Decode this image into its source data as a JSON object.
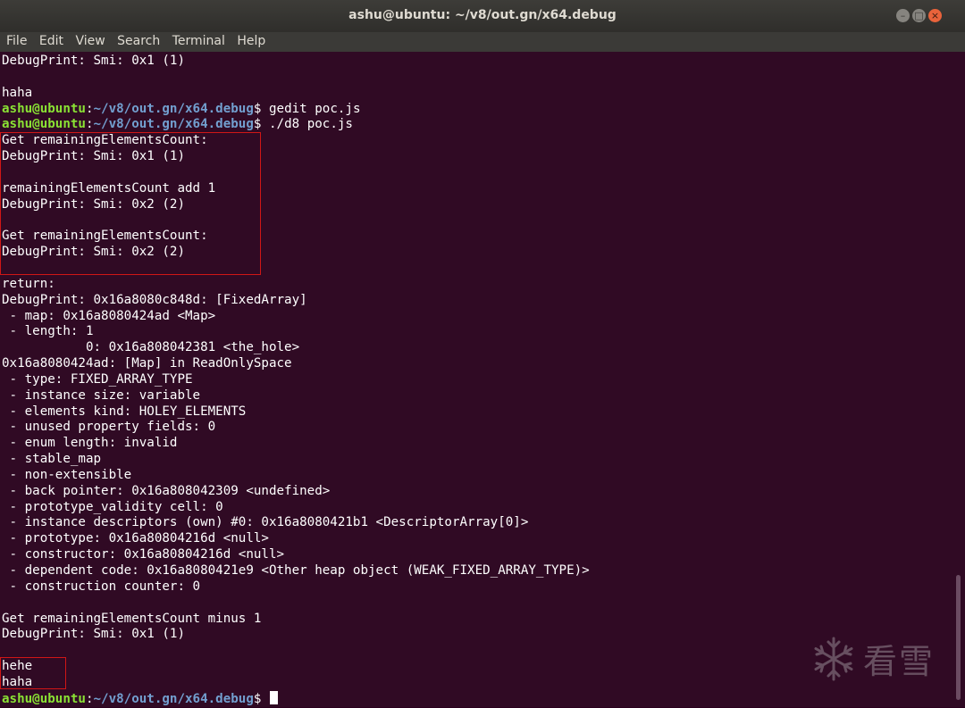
{
  "window": {
    "title": "ashu@ubuntu: ~/v8/out.gn/x64.debug"
  },
  "menu": [
    "File",
    "Edit",
    "View",
    "Search",
    "Terminal",
    "Help"
  ],
  "prompt": {
    "user": "ashu@ubuntu",
    "path": "~/v8/out.gn/x64.debug"
  },
  "lines": [
    {
      "kind": "out",
      "text": "DebugPrint: Smi: 0x1 (1)"
    },
    {
      "kind": "out",
      "text": ""
    },
    {
      "kind": "out",
      "text": "haha"
    },
    {
      "kind": "prompt",
      "text": "gedit poc.js"
    },
    {
      "kind": "prompt",
      "text": "./d8 poc.js"
    },
    {
      "kind": "out",
      "text": "Get remainingElementsCount:"
    },
    {
      "kind": "out",
      "text": "DebugPrint: Smi: 0x1 (1)"
    },
    {
      "kind": "out",
      "text": ""
    },
    {
      "kind": "out",
      "text": "remainingElementsCount add 1"
    },
    {
      "kind": "out",
      "text": "DebugPrint: Smi: 0x2 (2)"
    },
    {
      "kind": "out",
      "text": ""
    },
    {
      "kind": "out",
      "text": "Get remainingElementsCount:"
    },
    {
      "kind": "out",
      "text": "DebugPrint: Smi: 0x2 (2)"
    },
    {
      "kind": "out",
      "text": ""
    },
    {
      "kind": "out",
      "text": "return:"
    },
    {
      "kind": "out",
      "text": "DebugPrint: 0x16a8080c848d: [FixedArray]"
    },
    {
      "kind": "out",
      "text": " - map: 0x16a8080424ad <Map>"
    },
    {
      "kind": "out",
      "text": " - length: 1"
    },
    {
      "kind": "out",
      "text": "           0: 0x16a808042381 <the_hole>"
    },
    {
      "kind": "out",
      "text": "0x16a8080424ad: [Map] in ReadOnlySpace"
    },
    {
      "kind": "out",
      "text": " - type: FIXED_ARRAY_TYPE"
    },
    {
      "kind": "out",
      "text": " - instance size: variable"
    },
    {
      "kind": "out",
      "text": " - elements kind: HOLEY_ELEMENTS"
    },
    {
      "kind": "out",
      "text": " - unused property fields: 0"
    },
    {
      "kind": "out",
      "text": " - enum length: invalid"
    },
    {
      "kind": "out",
      "text": " - stable_map"
    },
    {
      "kind": "out",
      "text": " - non-extensible"
    },
    {
      "kind": "out",
      "text": " - back pointer: 0x16a808042309 <undefined>"
    },
    {
      "kind": "out",
      "text": " - prototype_validity cell: 0"
    },
    {
      "kind": "out",
      "text": " - instance descriptors (own) #0: 0x16a8080421b1 <DescriptorArray[0]>"
    },
    {
      "kind": "out",
      "text": " - prototype: 0x16a80804216d <null>"
    },
    {
      "kind": "out",
      "text": " - constructor: 0x16a80804216d <null>"
    },
    {
      "kind": "out",
      "text": " - dependent code: 0x16a8080421e9 <Other heap object (WEAK_FIXED_ARRAY_TYPE)>"
    },
    {
      "kind": "out",
      "text": " - construction counter: 0"
    },
    {
      "kind": "out",
      "text": ""
    },
    {
      "kind": "out",
      "text": "Get remainingElementsCount minus 1"
    },
    {
      "kind": "out",
      "text": "DebugPrint: Smi: 0x1 (1)"
    },
    {
      "kind": "out",
      "text": ""
    },
    {
      "kind": "out",
      "text": "hehe"
    },
    {
      "kind": "out",
      "text": "haha"
    },
    {
      "kind": "prompt-cursor",
      "text": ""
    }
  ],
  "watermark": {
    "icon": "snowflake-icon",
    "text": "看雪"
  },
  "colors": {
    "background": "#300a24",
    "prompt_user": "#8ae234",
    "prompt_path": "#729fcf",
    "highlight_box": "#d01616"
  }
}
